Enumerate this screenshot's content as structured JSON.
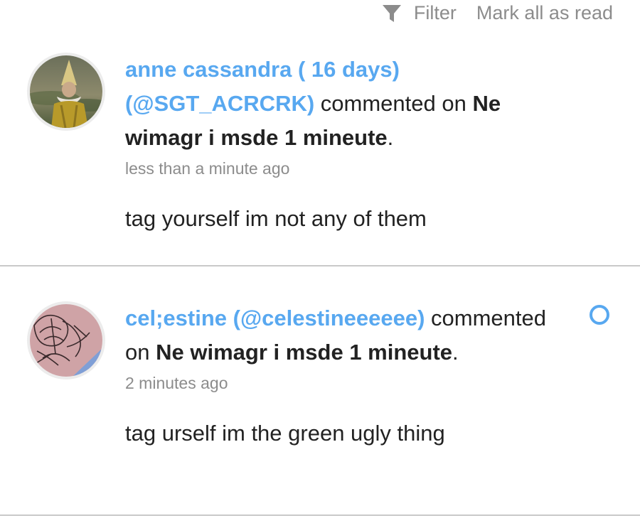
{
  "toolbar": {
    "filter_label": "Filter",
    "mark_all_label": "Mark all as read",
    "filter_icon": "filter-icon"
  },
  "notifications": [
    {
      "user": "anne cassandra ( 16 days) (@SGT_ACRCRK)",
      "action": "commented on",
      "post_title": "Ne wimagr i msde 1 mineute",
      "punct": ".",
      "time": "less than a minute ago",
      "comment": "tag yourself im not any of them",
      "unread": false
    },
    {
      "user": "cel;estine (@celestineeeeee)",
      "action": "commented on",
      "post_title": "Ne wimagr i msde 1 mineute",
      "punct": ".",
      "time": "2 minutes ago",
      "comment": "tag urself im the green ugly thing",
      "unread": true
    }
  ],
  "colors": {
    "accent": "#58a8f0",
    "muted": "#8c8c8c",
    "divider": "#c9c9c9"
  }
}
